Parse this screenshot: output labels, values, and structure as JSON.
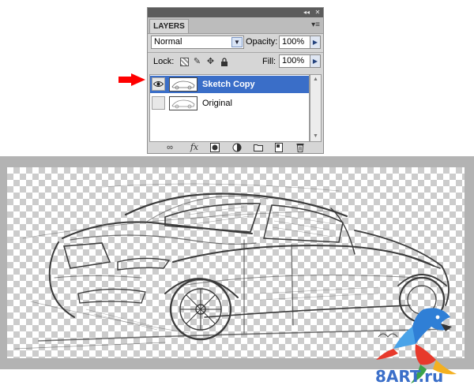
{
  "panel": {
    "tab_label": "LAYERS",
    "blend_mode": "Normal",
    "opacity_label": "Opacity:",
    "opacity_value": "100%",
    "lock_label": "Lock:",
    "fill_label": "Fill:",
    "fill_value": "100%",
    "layers": [
      {
        "name": "Sketch Copy",
        "visible": true,
        "selected": true
      },
      {
        "name": "Original",
        "visible": false,
        "selected": false
      }
    ],
    "footer_icons": [
      "link-layers-icon",
      "fx-icon",
      "layer-mask-icon",
      "adjustment-layer-icon",
      "new-group-icon",
      "new-layer-icon",
      "trash-icon"
    ]
  },
  "annotation": {
    "arrow_color": "#ff0000"
  },
  "watermark": {
    "text": "8ART.ru"
  },
  "colors": {
    "selection": "#3a6ec8",
    "panel_bg": "#d6d6d6",
    "canvas_frame": "#b3b3b3"
  }
}
